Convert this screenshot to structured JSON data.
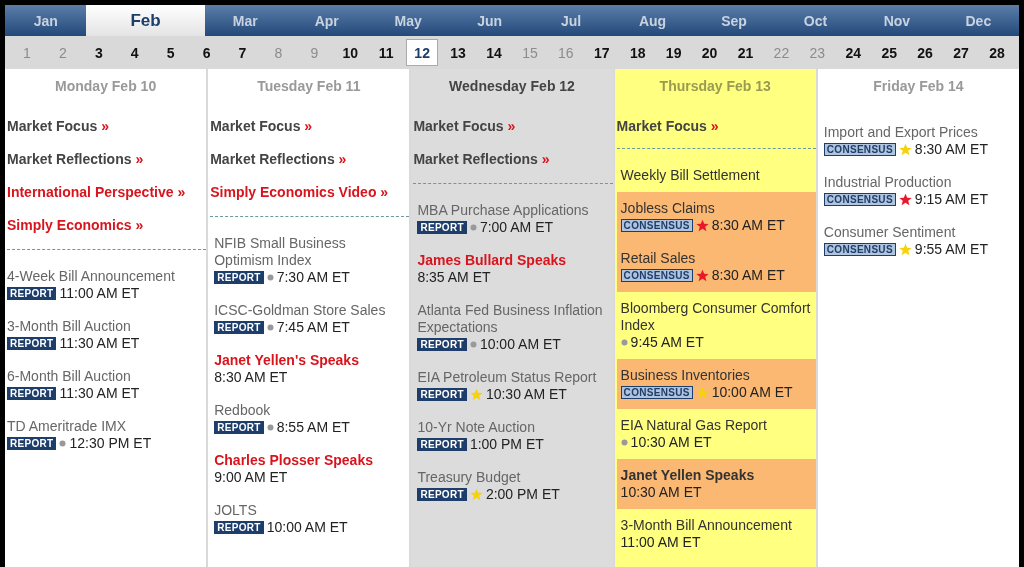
{
  "months": [
    {
      "label": "Jan",
      "selected": false
    },
    {
      "label": "Feb",
      "selected": true
    },
    {
      "label": "Mar",
      "selected": false
    },
    {
      "label": "Apr",
      "selected": false
    },
    {
      "label": "May",
      "selected": false
    },
    {
      "label": "Jun",
      "selected": false
    },
    {
      "label": "Jul",
      "selected": false
    },
    {
      "label": "Aug",
      "selected": false
    },
    {
      "label": "Sep",
      "selected": false
    },
    {
      "label": "Oct",
      "selected": false
    },
    {
      "label": "Nov",
      "selected": false
    },
    {
      "label": "Dec",
      "selected": false
    }
  ],
  "days": [
    {
      "label": "1",
      "disabled": true,
      "selected": false
    },
    {
      "label": "2",
      "disabled": true,
      "selected": false
    },
    {
      "label": "3",
      "disabled": false,
      "selected": false
    },
    {
      "label": "4",
      "disabled": false,
      "selected": false
    },
    {
      "label": "5",
      "disabled": false,
      "selected": false
    },
    {
      "label": "6",
      "disabled": false,
      "selected": false
    },
    {
      "label": "7",
      "disabled": false,
      "selected": false
    },
    {
      "label": "8",
      "disabled": true,
      "selected": false
    },
    {
      "label": "9",
      "disabled": true,
      "selected": false
    },
    {
      "label": "10",
      "disabled": false,
      "selected": false
    },
    {
      "label": "11",
      "disabled": false,
      "selected": false
    },
    {
      "label": "12",
      "disabled": false,
      "selected": true
    },
    {
      "label": "13",
      "disabled": false,
      "selected": false
    },
    {
      "label": "14",
      "disabled": false,
      "selected": false
    },
    {
      "label": "15",
      "disabled": true,
      "selected": false
    },
    {
      "label": "16",
      "disabled": true,
      "selected": false
    },
    {
      "label": "17",
      "disabled": false,
      "selected": false
    },
    {
      "label": "18",
      "disabled": false,
      "selected": false
    },
    {
      "label": "19",
      "disabled": false,
      "selected": false
    },
    {
      "label": "20",
      "disabled": false,
      "selected": false
    },
    {
      "label": "21",
      "disabled": false,
      "selected": false
    },
    {
      "label": "22",
      "disabled": true,
      "selected": false
    },
    {
      "label": "23",
      "disabled": true,
      "selected": false
    },
    {
      "label": "24",
      "disabled": false,
      "selected": false
    },
    {
      "label": "25",
      "disabled": false,
      "selected": false
    },
    {
      "label": "26",
      "disabled": false,
      "selected": false
    },
    {
      "label": "27",
      "disabled": false,
      "selected": false
    },
    {
      "label": "28",
      "disabled": false,
      "selected": false
    }
  ],
  "columns": [
    {
      "title": "Monday Feb 10",
      "kind": "plain",
      "links": [
        {
          "label": "Market Focus",
          "arrow": "»",
          "featured": false
        },
        {
          "label": "Market Reflections",
          "arrow": "»",
          "featured": false
        },
        {
          "label": "International Perspective",
          "arrow": "»",
          "featured": true
        },
        {
          "label": "Simply Economics",
          "arrow": "»",
          "featured": true
        }
      ],
      "events": [
        {
          "title": "4-Week Bill Announcement",
          "speaker": false,
          "badge": "REPORT",
          "bullet": false,
          "time": "11:00 AM ET",
          "highlighted": false
        },
        {
          "title": "3-Month Bill Auction",
          "speaker": false,
          "badge": "REPORT",
          "bullet": false,
          "time": "11:30 AM ET",
          "highlighted": false
        },
        {
          "title": "6-Month Bill Auction",
          "speaker": false,
          "badge": "REPORT",
          "bullet": false,
          "time": "11:30 AM ET",
          "highlighted": false
        },
        {
          "title": "TD Ameritrade IMX",
          "speaker": false,
          "badge": "REPORT",
          "bullet": true,
          "time": "12:30 PM ET",
          "highlighted": false
        }
      ]
    },
    {
      "title": "Tuesday Feb 11",
      "kind": "plain",
      "links": [
        {
          "label": "Market Focus",
          "arrow": "»",
          "featured": false
        },
        {
          "label": "Market Reflections",
          "arrow": "»",
          "featured": false
        },
        {
          "label": "Simply Economics Video",
          "arrow": "»",
          "featured": true
        }
      ],
      "events": [
        {
          "title": "NFIB Small Business Optimism Index",
          "speaker": false,
          "badge": "REPORT",
          "bullet": true,
          "time": "7:30 AM ET",
          "highlighted": false
        },
        {
          "title": "ICSC-Goldman Store Sales",
          "speaker": false,
          "badge": "REPORT",
          "bullet": true,
          "time": "7:45 AM ET",
          "highlighted": false
        },
        {
          "title": "Janet Yellen's Speaks",
          "speaker": true,
          "bullet": false,
          "time": "8:30 AM ET",
          "highlighted": false
        },
        {
          "title": "Redbook",
          "speaker": false,
          "badge": "REPORT",
          "bullet": true,
          "time": "8:55 AM ET",
          "highlighted": false
        },
        {
          "title": "Charles Plosser Speaks",
          "speaker": true,
          "bullet": false,
          "time": "9:00 AM ET",
          "highlighted": false
        },
        {
          "title": "JOLTS",
          "speaker": false,
          "badge": "REPORT",
          "bullet": false,
          "time": "10:00 AM ET",
          "highlighted": false
        }
      ]
    },
    {
      "title": "Wednesday Feb 12",
      "kind": "today",
      "links": [
        {
          "label": "Market Focus",
          "arrow": "»",
          "featured": false
        },
        {
          "label": "Market Reflections",
          "arrow": "»",
          "featured": false
        }
      ],
      "events": [
        {
          "title": "MBA Purchase Applications",
          "speaker": false,
          "badge": "REPORT",
          "bullet": true,
          "time": "7:00 AM ET",
          "highlighted": false
        },
        {
          "title": "James Bullard Speaks",
          "speaker": true,
          "bullet": false,
          "time": "8:35 AM ET",
          "highlighted": false
        },
        {
          "title": "Atlanta Fed Business Inflation Expectations",
          "speaker": false,
          "badge": "REPORT",
          "bullet": true,
          "time": "10:00 AM ET",
          "highlighted": false
        },
        {
          "title": "EIA Petroleum Status Report",
          "speaker": false,
          "badge": "REPORT",
          "bullet": false,
          "color": "#f5d20c",
          "time": "10:30 AM ET",
          "highlighted": false
        },
        {
          "title": "10-Yr Note Auction",
          "speaker": false,
          "badge": "REPORT",
          "bullet": false,
          "time": "1:00 PM ET",
          "highlighted": false
        },
        {
          "title": "Treasury Budget",
          "speaker": false,
          "badge": "REPORT",
          "bullet": false,
          "color": "#f5d20c",
          "time": "2:00 PM ET",
          "highlighted": false
        }
      ]
    },
    {
      "title": "Thursday Feb 13",
      "kind": "next",
      "links": [
        {
          "label": "Market Focus",
          "arrow": "»",
          "featured": false
        }
      ],
      "events": [
        {
          "title": "Weekly Bill Settlement",
          "speaker": false,
          "bullet": false,
          "highlighted": false
        },
        {
          "title": "Jobless Claims",
          "speaker": false,
          "badge": "CONSENSUS",
          "bullet": false,
          "color": "#e8182a",
          "time": "8:30 AM ET",
          "highlighted": true
        },
        {
          "title": "Retail Sales",
          "speaker": false,
          "badge": "CONSENSUS",
          "bullet": false,
          "color": "#e8182a",
          "time": "8:30 AM ET",
          "highlighted": true
        },
        {
          "title": "Bloomberg Consumer Comfort Index",
          "speaker": false,
          "bullet": true,
          "time": "9:45 AM ET",
          "highlighted": false
        },
        {
          "title": "Business Inventories",
          "speaker": false,
          "badge": "CONSENSUS",
          "bullet": false,
          "color": "#f5d20c",
          "time": "10:00 AM ET",
          "highlighted": true
        },
        {
          "title": "EIA Natural Gas Report",
          "speaker": false,
          "bullet": true,
          "time": "10:30 AM ET",
          "highlighted": false
        },
        {
          "title": "Janet Yellen Speaks",
          "speaker": true,
          "bullet": false,
          "time": "10:30 AM ET",
          "highlighted": true
        },
        {
          "title": "3-Month Bill Announcement",
          "speaker": false,
          "bullet": false,
          "time": "11:00 AM ET",
          "highlighted": false
        }
      ]
    },
    {
      "title": "Friday Feb 14",
      "kind": "plain",
      "events": [
        {
          "title": "Import and Export Prices",
          "speaker": false,
          "badge": "CONSENSUS",
          "bullet": false,
          "color": "#f5d20c",
          "time": "8:30 AM ET",
          "highlighted": false
        },
        {
          "title": "Industrial Production",
          "speaker": false,
          "badge": "CONSENSUS",
          "bullet": false,
          "color": "#e8182a",
          "time": "9:15 AM ET",
          "highlighted": false
        },
        {
          "title": "Consumer Sentiment",
          "speaker": false,
          "badge": "CONSENSUS",
          "bullet": false,
          "color": "#f5d20c",
          "time": "9:55 AM ET",
          "highlighted": false
        }
      ]
    }
  ]
}
